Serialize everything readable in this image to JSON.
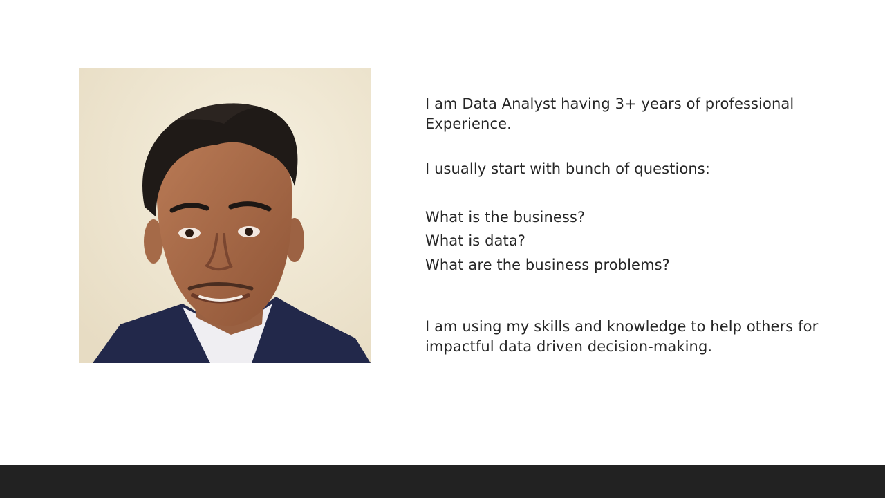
{
  "slide": {
    "photo_alt": "portrait-photo",
    "paragraphs": {
      "intro": "I am Data Analyst having 3+ years of professional Experience.",
      "start": "I usually start with bunch of questions:",
      "questions": [
        "What is the business?",
        "What is data?",
        "What are the business problems?"
      ],
      "outro": "I am using my skills and knowledge to help others for impactful data driven decision-making."
    }
  },
  "colors": {
    "text": "#262626",
    "footer_bar": "#222222",
    "photo_background": "#efe6d1"
  }
}
